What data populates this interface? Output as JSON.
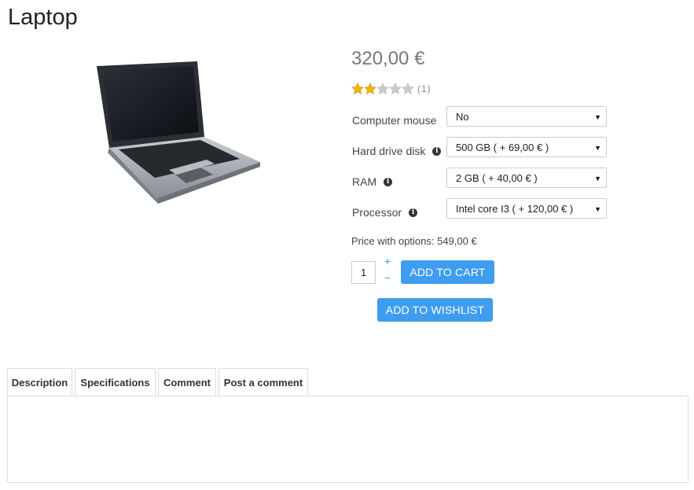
{
  "product": {
    "title": "Laptop",
    "price": "320,00 €",
    "rating": {
      "value": 2,
      "max": 5,
      "count_label": "(1)"
    }
  },
  "options": [
    {
      "label": "Computer mouse",
      "has_info": false,
      "value": "No"
    },
    {
      "label": "Hard drive disk",
      "has_info": true,
      "value": "500 GB ( + 69,00 € )"
    },
    {
      "label": "RAM",
      "has_info": true,
      "value": "2 GB ( + 40,00 € )"
    },
    {
      "label": "Processor",
      "has_info": true,
      "value": "Intel core I3 ( + 120,00 € )"
    }
  ],
  "price_with_options": "Price with options: 549,00 €",
  "quantity": {
    "value": "1",
    "plus": "+",
    "minus": "−"
  },
  "buttons": {
    "add_to_cart": "ADD TO CART",
    "add_to_wishlist": "ADD TO WISHLIST"
  },
  "tabs": [
    {
      "label": "Description"
    },
    {
      "label": "Specifications"
    },
    {
      "label": "Comment"
    },
    {
      "label": "Post a comment"
    }
  ],
  "colors": {
    "button": "#3f9df0",
    "price": "#777777",
    "star_filled": "#f2b705",
    "star_empty": "#cccccc"
  }
}
